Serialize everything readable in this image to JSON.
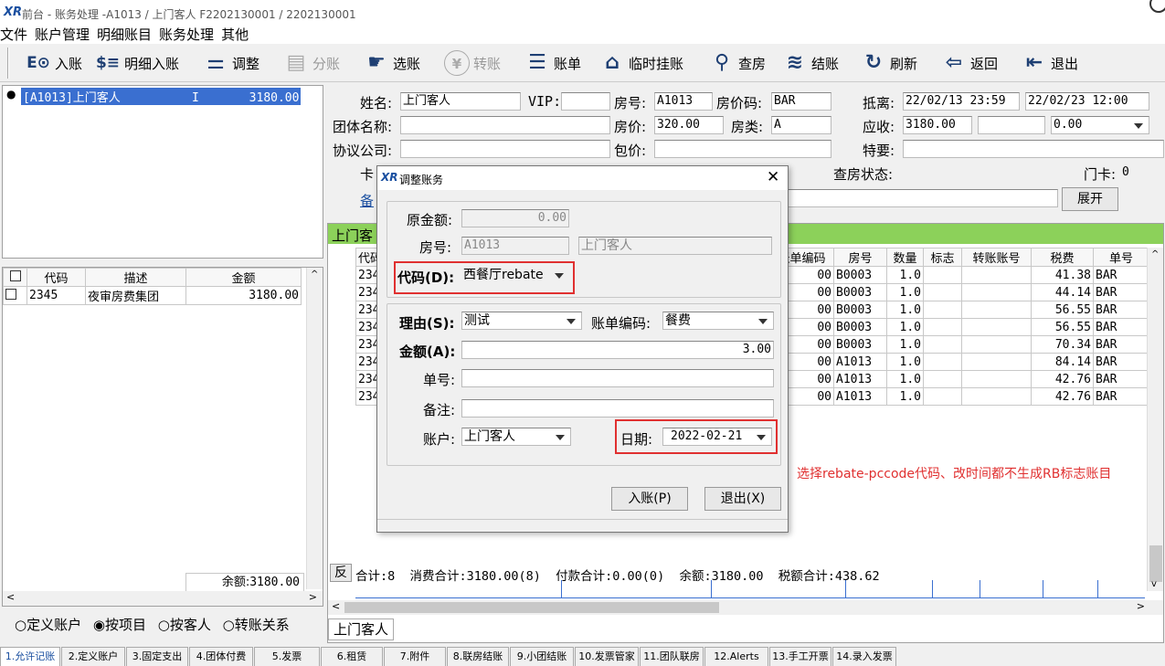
{
  "titlebar": {
    "text": "前台 - 账务处理 -A1013  /  上门客人  F2202130001  /  2202130001",
    "logo": "XR"
  },
  "menu": [
    "文件",
    "账户管理",
    "明细账目",
    "账务处理",
    "其他"
  ],
  "toolbar": [
    {
      "label": "入账",
      "icon": "ledger-icon",
      "glyph": "E⊙",
      "enabled": true
    },
    {
      "label": "明细入账",
      "icon": "dollar-list-icon",
      "glyph": "$≡",
      "enabled": true
    },
    {
      "label": "调整",
      "icon": "sliders-icon",
      "glyph": "⚌",
      "enabled": true
    },
    {
      "label": "分账",
      "icon": "split-icon",
      "glyph": "▤",
      "enabled": false
    },
    {
      "label": "选账",
      "icon": "pointer-hand-icon",
      "glyph": "☛",
      "enabled": true
    },
    {
      "label": "转账",
      "icon": "transfer-icon",
      "glyph": "¥",
      "enabled": false
    },
    {
      "label": "账单",
      "icon": "bill-icon",
      "glyph": "☰",
      "enabled": true
    },
    {
      "label": "临时挂账",
      "icon": "house-icon",
      "glyph": "⌂",
      "enabled": true
    },
    {
      "label": "查房",
      "icon": "search-icon",
      "glyph": "⚲",
      "enabled": true
    },
    {
      "label": "结账",
      "icon": "checkout-icon",
      "glyph": "≋",
      "enabled": true
    },
    {
      "label": "刷新",
      "icon": "refresh-icon",
      "glyph": "↻",
      "enabled": true
    },
    {
      "label": "返回",
      "icon": "back-arrow-icon",
      "glyph": "⇦",
      "enabled": true
    },
    {
      "label": "退出",
      "icon": "exit-icon",
      "glyph": "⇤",
      "enabled": true
    }
  ],
  "account_tree": {
    "item": "[A1013]上门客人          I       3180.00"
  },
  "left_grid": {
    "headers": [
      "代码",
      "描述",
      "金额"
    ],
    "rows": [
      {
        "code": "2345",
        "desc": "夜审房费集团",
        "amount": "3180.00"
      }
    ],
    "balance_label": "余额:",
    "balance": "3180.00"
  },
  "radio_options": [
    {
      "label": "定义账户",
      "checked": false
    },
    {
      "label": "按项目",
      "checked": true
    },
    {
      "label": "按客人",
      "checked": false
    },
    {
      "label": "转账关系",
      "checked": false
    }
  ],
  "left_tab": "上门客人",
  "guest": {
    "name_label": "姓名:",
    "name": "上门客人",
    "vip_label": "VIP:",
    "vip": "",
    "room_label": "房号:",
    "room": "A1013",
    "rate_code_label": "房价码:",
    "rate_code": "BAR",
    "depart_label": "抵离:",
    "arrive": "22/02/13 23:59",
    "depart": "22/02/23 12:00",
    "group_label": "团体名称:",
    "group": "",
    "price_label": "房价:",
    "price": "320.00",
    "room_type_label": "房类:",
    "room_type": "A",
    "receivable_label": "应收:",
    "receivable": "3180.00",
    "receivable2": "",
    "receivable3": "0.00",
    "company_label": "协议公司:",
    "company": "",
    "package_label": "包价:",
    "package": "",
    "special_label": "特要:",
    "special": "",
    "card_label": "卡",
    "inspect_label": "查房状态:",
    "door_card_label": "门卡:",
    "door_card": "0",
    "note_label": "备",
    "expand_btn": "展开"
  },
  "right_grid": {
    "tab_label": "上门客",
    "headers": [
      "代码",
      "账单编码",
      "房号",
      "数量",
      "标志",
      "转账账号",
      "税费",
      "单号"
    ],
    "rows": [
      {
        "code": "234",
        "bill": "00",
        "room": "B0003",
        "qty": "1.0",
        "flag": "",
        "acct": "",
        "tax": "41.38",
        "no": "BAR"
      },
      {
        "code": "234",
        "bill": "00",
        "room": "B0003",
        "qty": "1.0",
        "flag": "",
        "acct": "",
        "tax": "44.14",
        "no": "BAR"
      },
      {
        "code": "234",
        "bill": "00",
        "room": "B0003",
        "qty": "1.0",
        "flag": "",
        "acct": "",
        "tax": "56.55",
        "no": "BAR"
      },
      {
        "code": "234",
        "bill": "00",
        "room": "B0003",
        "qty": "1.0",
        "flag": "",
        "acct": "",
        "tax": "56.55",
        "no": "BAR"
      },
      {
        "code": "234",
        "bill": "00",
        "room": "B0003",
        "qty": "1.0",
        "flag": "",
        "acct": "",
        "tax": "70.34",
        "no": "BAR"
      },
      {
        "code": "234",
        "bill": "00",
        "room": "A1013",
        "qty": "1.0",
        "flag": "",
        "acct": "",
        "tax": "84.14",
        "no": "BAR"
      },
      {
        "code": "234",
        "bill": "00",
        "room": "A1013",
        "qty": "1.0",
        "flag": "",
        "acct": "",
        "tax": "42.76",
        "no": "BAR"
      },
      {
        "code": "234",
        "bill": "00",
        "room": "A1013",
        "qty": "1.0",
        "flag": "",
        "acct": "",
        "tax": "42.76",
        "no": "BAR"
      }
    ],
    "summary_btn": "反",
    "summary": "合计:8  消费合计:3180.00(8)  付款合计:0.00(0)  余额:3180.00  税额合计:438.62"
  },
  "annotation": "选择rebate-pccode代码、改时间都不生成RB标志账目",
  "dialog": {
    "title": "调整账务",
    "orig_amount_label": "原金额:",
    "orig_amount": "0.00",
    "room_label": "房号:",
    "room": "A1013",
    "guest": "上门客人",
    "code_label": "代码(D):",
    "code": "西餐厅rebate",
    "reason_label": "理由(S):",
    "reason": "测试",
    "bill_code_label": "账单编码:",
    "bill_code": "餐费",
    "amount_label": "金额(A):",
    "amount": "3.00",
    "no_label": "单号:",
    "no": "",
    "note_label": "备注:",
    "note": "",
    "account_label": "账户:",
    "account": "上门客人",
    "date_label": "日期:",
    "date": "2022-02-21",
    "post_btn": "入账(P)",
    "exit_btn": "退出(X)"
  },
  "bottom_tabs": [
    "1.允许记账",
    "2.定义账户",
    "3.固定支出",
    "4.团体付费",
    "5.发票",
    "6.租赁",
    "7.附件",
    "8.联房结账",
    "9.小团结账",
    "10.发票管家",
    "11.团队联房",
    "12.Alerts",
    "13.手工开票",
    "14.录入发票"
  ],
  "colors": {
    "accent_green": "#8cd15a",
    "selection": "#3a6fd0",
    "annotation_red": "#e03030",
    "link_blue": "#1a4fa0"
  }
}
